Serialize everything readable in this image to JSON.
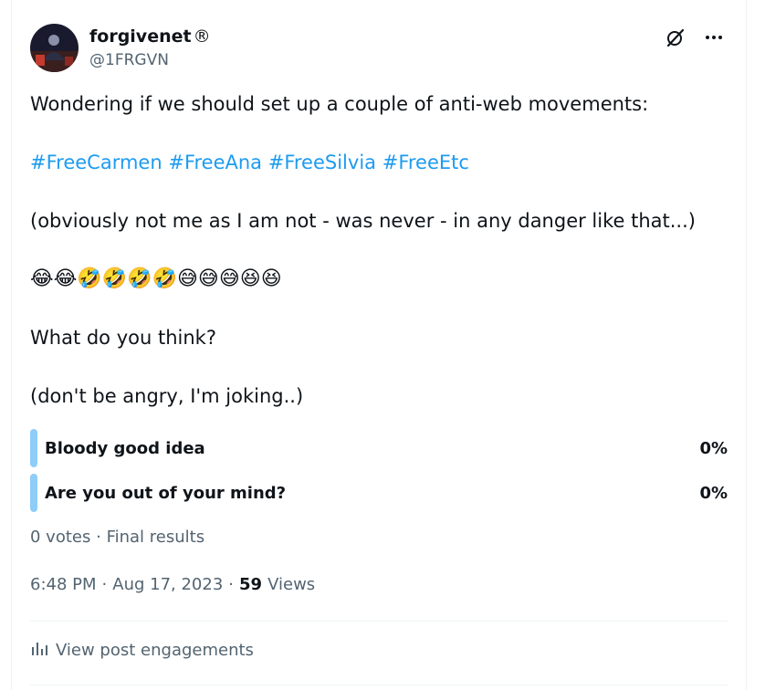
{
  "post": {
    "author_name": "forgivenet",
    "author_reg_mark": "®",
    "author_handle": "@1FRGVN",
    "paragraphs": {
      "p1": "Wondering if we should set up a couple of anti-web movements:",
      "p3": "(obviously not me as I am not - was never - in any danger like that...)",
      "p4": "😂😂🤣🤣🤣🤣😅😅😅😆😆",
      "p5": "What do you think?",
      "p6": "(don't be angry, I'm joking..)"
    },
    "hashtags": [
      "#FreeCarmen",
      "#FreeAna",
      "#FreeSilvia",
      "#FreeEtc"
    ]
  },
  "poll": {
    "options": [
      {
        "label": "Bloody good idea",
        "percent": "0%"
      },
      {
        "label": "Are you out of your mind?",
        "percent": "0%"
      }
    ],
    "votes": "0 votes",
    "separator": "·",
    "status": "Final results"
  },
  "meta": {
    "time": "6:48 PM",
    "sep": "·",
    "date": "Aug 17, 2023",
    "views_count": "59",
    "views_label": "Views"
  },
  "actions": {
    "engagements_label": "View post engagements"
  },
  "colors": {
    "accent": "#1d9bf0",
    "muted": "#536471",
    "poll_bar": "#8ecdf8"
  }
}
